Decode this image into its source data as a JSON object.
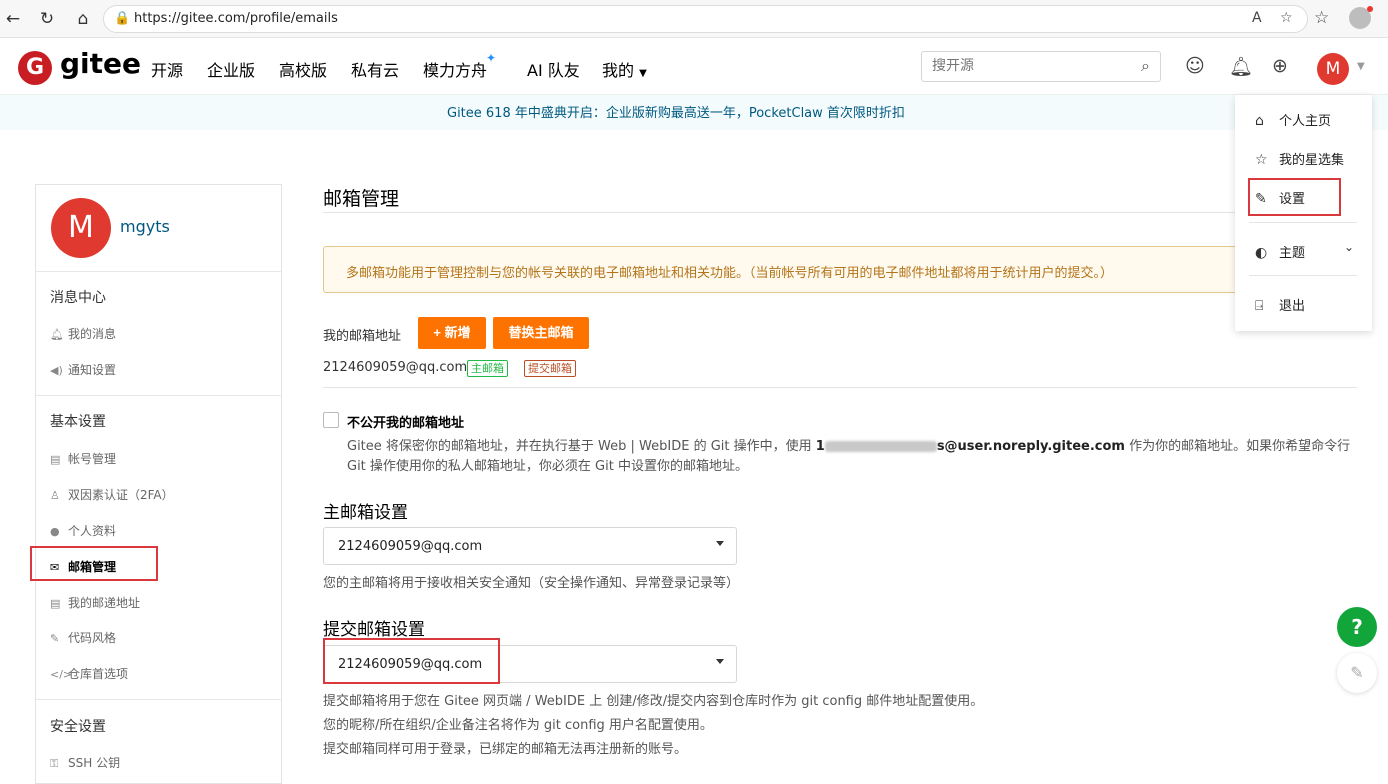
{
  "browser": {
    "url": "https://gitee.com/profile/emails",
    "read_aloud": "A",
    "icons": [
      "back-icon",
      "refresh-icon",
      "home-icon",
      "lock-icon",
      "read-aloud-icon",
      "favorite-icon",
      "favorites-icon",
      "profile-icon"
    ]
  },
  "header": {
    "logo_text": "gitee",
    "nav": [
      "开源",
      "企业版",
      "高校版",
      "私有云",
      "模力方舟",
      "AI 队友",
      "我的"
    ],
    "search_placeholder": "搜开源",
    "avatar_letter": "M"
  },
  "banner": {
    "text": "Gitee 618 年中盛典开启：企业版新购最高送一年，PocketClaw 首次限时折扣"
  },
  "sidebar": {
    "avatar_letter": "M",
    "username": "mgyts",
    "groups": [
      {
        "title": "消息中心",
        "items": [
          "我的消息",
          "通知设置"
        ]
      },
      {
        "title": "基本设置",
        "items": [
          "帐号管理",
          "双因素认证（2FA）",
          "个人资料",
          "邮箱管理",
          "我的邮递地址",
          "代码风格",
          "仓库首选项"
        ]
      },
      {
        "title": "安全设置",
        "items": [
          "SSH 公钥"
        ]
      }
    ]
  },
  "main": {
    "title": "邮箱管理",
    "notice": "多邮箱功能用于管理控制与您的帐号关联的电子邮箱地址和相关功能。（当前帐号所有可用的电子邮件地址都将用于统计用户的提交。）",
    "emails_label": "我的邮箱地址",
    "add_button": "+ 新增",
    "replace_button": "替换主邮箱",
    "email": "2124609059@qq.com",
    "tag_primary": "主邮箱",
    "tag_commit": "提交邮箱",
    "hide_email": {
      "label": "不公开我的邮箱地址",
      "desc1_a": "Gitee 将保密你的邮箱地址，并在执行基于 Web | WebIDE 的 Git 操作中，使用",
      "desc1_b": "1",
      "desc1_c": "s@user.noreply.gitee.com",
      "desc1_d": "作为你的邮箱地址。如果你希望命令行",
      "desc2": "Git 操作使用你的私人邮箱地址，你必须在 Git 中设置你的邮箱地址。"
    },
    "primary_section": {
      "title": "主邮箱设置",
      "value": "2124609059@qq.com",
      "hint": "您的主邮箱将用于接收相关安全通知（安全操作通知、异常登录记录等）"
    },
    "commit_section": {
      "title": "提交邮箱设置",
      "value": "2124609059@qq.com",
      "hint1": "提交邮箱将用于您在 Gitee 网页端 / WebIDE 上 创建/修改/提交内容到仓库时作为 git config 邮件地址配置使用。",
      "hint2": "您的昵称/所在组织/企业备注名将作为 git config 用户名配置使用。",
      "hint3": "提交邮箱同样可用于登录，已绑定的邮箱无法再注册新的账号。"
    }
  },
  "dropdown": {
    "items": [
      "个人主页",
      "我的星选集",
      "设置",
      "主题",
      "退出"
    ]
  },
  "floating": {
    "help": "?"
  },
  "colors": {
    "brand": "#c71d23",
    "accent": "#fe7300",
    "link": "#005980",
    "highlight": "#d9393c"
  }
}
